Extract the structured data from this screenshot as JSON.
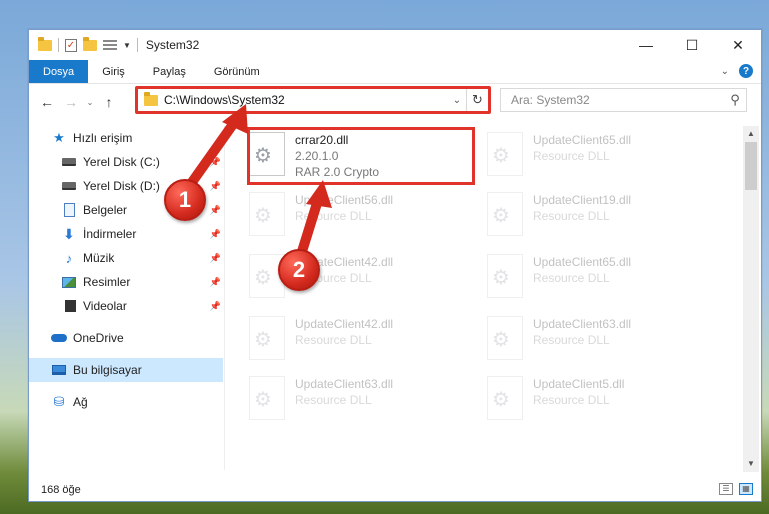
{
  "window": {
    "title": "System32",
    "controls": {
      "minimize": "—",
      "maximize": "☐",
      "close": "✕"
    }
  },
  "ribbon": {
    "tabs": [
      {
        "label": "Dosya",
        "active": true
      },
      {
        "label": "Giriş"
      },
      {
        "label": "Paylaş"
      },
      {
        "label": "Görünüm"
      }
    ],
    "help": "?"
  },
  "nav": {
    "back": "←",
    "forward": "→",
    "recent": "⌄",
    "up": "↑",
    "address": "C:\\Windows\\System32",
    "search_placeholder": "Ara: System32"
  },
  "sidebar": {
    "items": [
      {
        "label": "Hızlı erişim",
        "icon": "star-icon"
      },
      {
        "label": "Yerel Disk (C:)",
        "icon": "disk-icon",
        "pinned": true
      },
      {
        "label": "Yerel Disk (D:)",
        "icon": "disk-icon",
        "pinned": true
      },
      {
        "label": "Belgeler",
        "icon": "document-icon",
        "pinned": true
      },
      {
        "label": "İndirmeler",
        "icon": "download-icon",
        "pinned": true
      },
      {
        "label": "Müzik",
        "icon": "music-icon",
        "pinned": true
      },
      {
        "label": "Resimler",
        "icon": "pictures-icon",
        "pinned": true
      },
      {
        "label": "Videolar",
        "icon": "videos-icon",
        "pinned": true
      },
      {
        "label": "OneDrive",
        "icon": "cloud-icon"
      },
      {
        "label": "Bu bilgisayar",
        "icon": "computer-icon",
        "selected": true
      },
      {
        "label": "Ağ",
        "icon": "network-icon"
      }
    ]
  },
  "files": [
    {
      "name": "crrar20.dll",
      "line1": "2.20.1.0",
      "line2": "RAR 2.0 Crypto",
      "highlighted": true
    },
    {
      "name": "UpdateClient65.dll",
      "line1": "Resource DLL"
    },
    {
      "name": "UpdateClient56.dll",
      "line1": "Resource DLL"
    },
    {
      "name": "UpdateClient19.dll",
      "line1": "Resource DLL"
    },
    {
      "name": "UpdateClient42.dll",
      "line1": "Resource DLL"
    },
    {
      "name": "UpdateClient65.dll",
      "line1": "Resource DLL"
    },
    {
      "name": "UpdateClient42.dll",
      "line1": "Resource DLL"
    },
    {
      "name": "UpdateClient63.dll",
      "line1": "Resource DLL"
    },
    {
      "name": "UpdateClient63.dll",
      "line1": "Resource DLL"
    },
    {
      "name": "UpdateClient5.dll",
      "line1": "Resource DLL"
    }
  ],
  "status": {
    "count": "168 öğe"
  },
  "annotations": {
    "step1": "1",
    "step2": "2"
  },
  "colors": {
    "accent": "#1979ca",
    "highlight": "#e0342b"
  }
}
